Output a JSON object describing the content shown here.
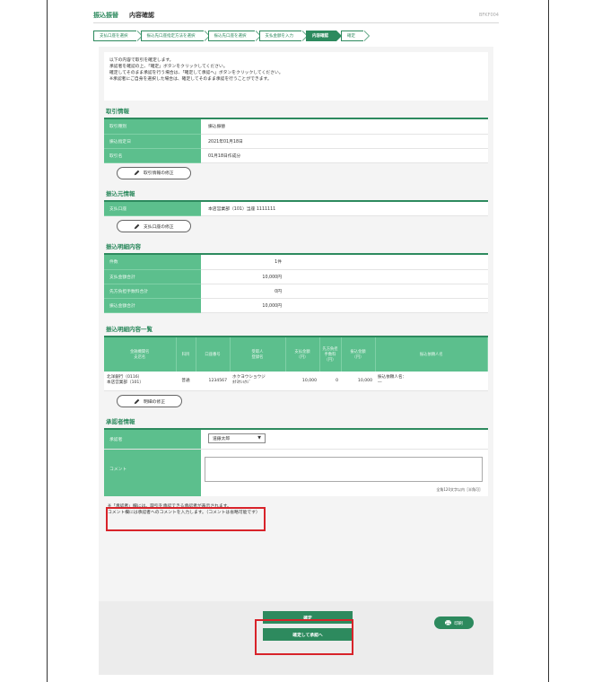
{
  "header": {
    "category": "振込振替",
    "title": "内容確認",
    "screen_id": "BFKF004"
  },
  "steps": [
    "支払口座を選択",
    "振込先口座指定方法を選択",
    "振込先口座を選択",
    "支払金額を入力",
    "内容確認",
    "確定"
  ],
  "intro": [
    "以下の内容で取引を確定します。",
    "承認者を確認の上、「確定」ボタンをクリックしてください。",
    "確定してそのまま承認を行う場合は、「確定して承認へ」ボタンをクリックしてください。",
    "※承認者にご自身を選択した場合は、確定してそのまま承認を行うことができます。"
  ],
  "transaction": {
    "title": "取引情報",
    "rows": [
      {
        "k": "取引種別",
        "v": "振込振替"
      },
      {
        "k": "振込指定日",
        "v": "2021年01月18日"
      },
      {
        "k": "取引名",
        "v": "01月18日作成分"
      }
    ],
    "edit": "取引情報の修正"
  },
  "source": {
    "title": "振込元情報",
    "rows": [
      {
        "k": "支払口座",
        "v": "本店営業部（101）当座 1111111"
      }
    ],
    "edit": "支払口座の修正"
  },
  "detail": {
    "title": "振込明細内容",
    "rows": [
      {
        "k": "件数",
        "v": "1件"
      },
      {
        "k": "支払金額合計",
        "v": "10,000円"
      },
      {
        "k": "先方負担手数料合計",
        "v": "0円"
      },
      {
        "k": "振込金額合計",
        "v": "10,000円"
      }
    ]
  },
  "list": {
    "title": "振込明細内容一覧",
    "headers": [
      "金融機関名\n支店名",
      "科目",
      "口座番号",
      "受取人\n登録名",
      "支払金額\n（円）",
      "先方負担\n手数料\n（円）",
      "振込金額\n（円）",
      "振込依頼人名"
    ],
    "row": [
      "北洋銀行（0116）\n本店営業部（101）",
      "普通",
      "1234567",
      "ホクヨウショウジ\nﾎｸﾖｳｼｮｳｼﾞ",
      "10,000",
      "0",
      "10,000",
      "振込依頼人名：\n―"
    ],
    "edit": "明細の修正"
  },
  "approver": {
    "title": "承認者情報",
    "label": "承認者",
    "selected": "道銀太郎",
    "comment_label": "コメント",
    "counter": "全角120文字以内［半角可］"
  },
  "notes": [
    "※「承認者」欄には、取引を承認できる承認者が表示されます。",
    "コメント欄には承認者へのコメントを入力します。（コメントは省略可能です）"
  ],
  "buttons": {
    "confirm": "確定",
    "confirm_approve": "確定して承認へ",
    "print": "印刷"
  }
}
